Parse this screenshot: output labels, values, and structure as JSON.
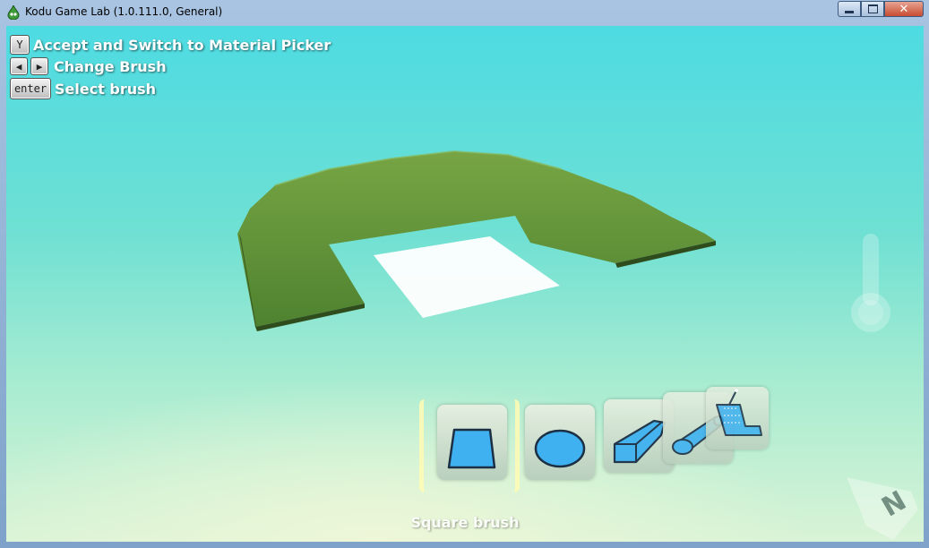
{
  "window": {
    "title": "Kodu Game Lab (1.0.111.0, General)",
    "controls": [
      "minimize",
      "maximize",
      "close"
    ]
  },
  "hints": [
    {
      "keys": [
        "Y"
      ],
      "label": "Accept and Switch to Material Picker"
    },
    {
      "keys": [
        "left-arrow",
        "right-arrow"
      ],
      "label": "Change Brush"
    },
    {
      "keys": [
        "enter"
      ],
      "label": "Select brush"
    }
  ],
  "brushes": {
    "items": [
      {
        "icon": "square-brush-icon",
        "selected": true
      },
      {
        "icon": "round-brush-icon",
        "selected": false
      },
      {
        "icon": "linear-square-brush-icon",
        "selected": false
      },
      {
        "icon": "linear-round-brush-icon",
        "selected": false
      },
      {
        "icon": "magic-brush-icon",
        "selected": false
      }
    ],
    "caption": "Square brush"
  },
  "compass": {
    "label": "N"
  },
  "colors": {
    "sky": "#4ddbe2",
    "grass": "#5f8f34",
    "brush_fill": "#3fb0f0",
    "selection_glow": "#fffab4"
  }
}
